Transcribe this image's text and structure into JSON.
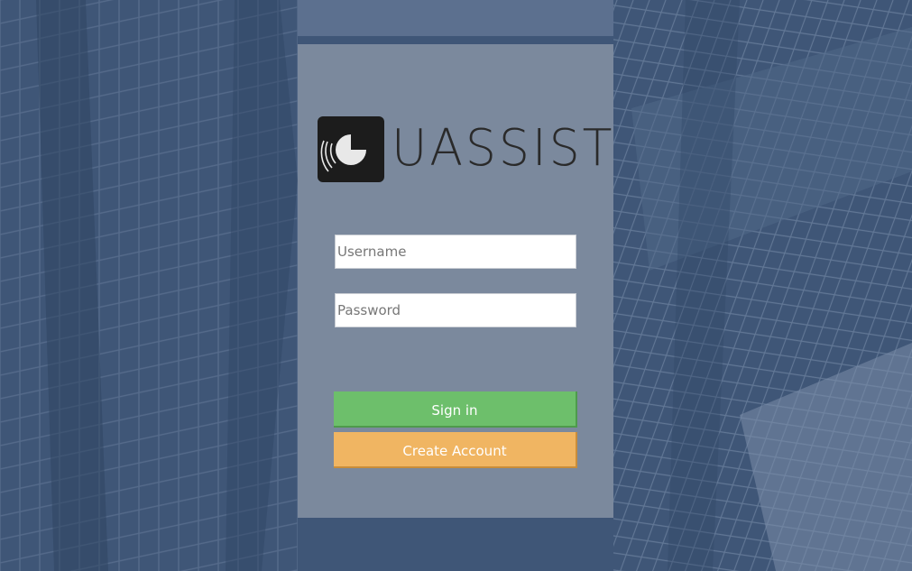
{
  "background": {
    "color": "#3f5677",
    "description_icon": "building-facade-background"
  },
  "logo": {
    "text": "UASSIST",
    "icon": "logo-mark-icon"
  },
  "form": {
    "username_placeholder": "Username",
    "password_placeholder": "Password",
    "username_value": "",
    "password_value": ""
  },
  "buttons": {
    "signin_label": "Sign in",
    "signin_color": "#6dbf6b",
    "create_label": "Create Account",
    "create_color": "#f0b562"
  }
}
